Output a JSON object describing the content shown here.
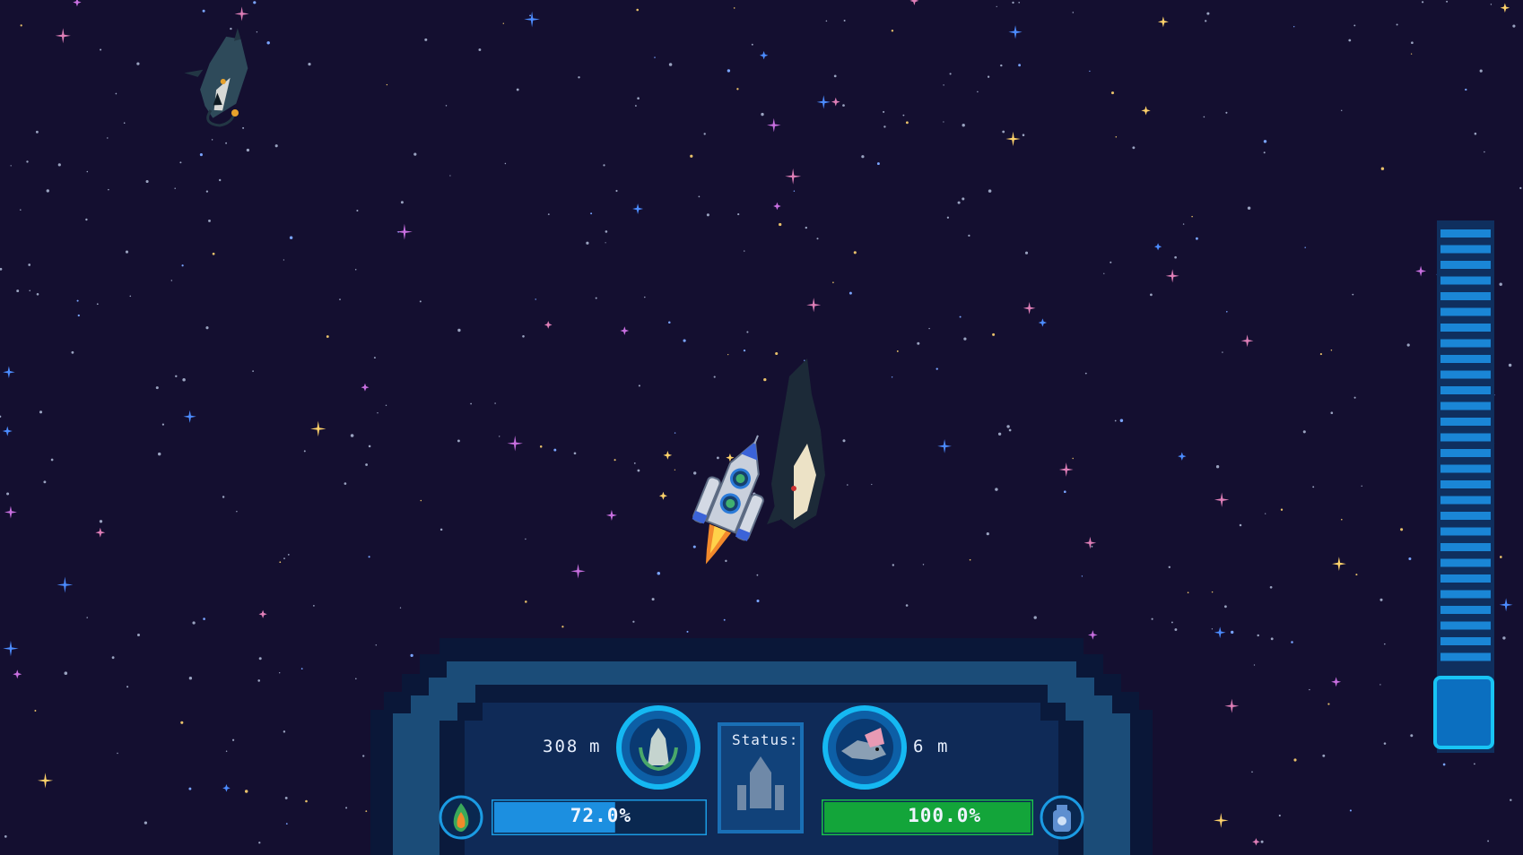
{
  "hud": {
    "distance_left": "308",
    "distance_left_unit": "m",
    "distance_right": "6",
    "distance_right_unit": "m",
    "status_label": "Status:",
    "fuel_percent": "72.0%",
    "fuel_fraction": 0.72,
    "oxygen_percent": "100.0%",
    "oxygen_fraction": 1.0
  },
  "gauge": {
    "segments_total": 28,
    "level_fraction": 1.0
  },
  "icons": {
    "fuel": "fire-icon",
    "oxygen": "canister-icon",
    "left_target": "plant-base-icon",
    "right_target": "anglerfish-icon",
    "status": "rocket-status-icon"
  },
  "colors": {
    "background": "#140f30",
    "hud_panel": "#0f2a57",
    "hud_border": "#1c4f7a",
    "accent_cyan": "#10b7f0",
    "fuel_bar": "#1c8fe0",
    "oxygen_bar": "#13a53a"
  }
}
